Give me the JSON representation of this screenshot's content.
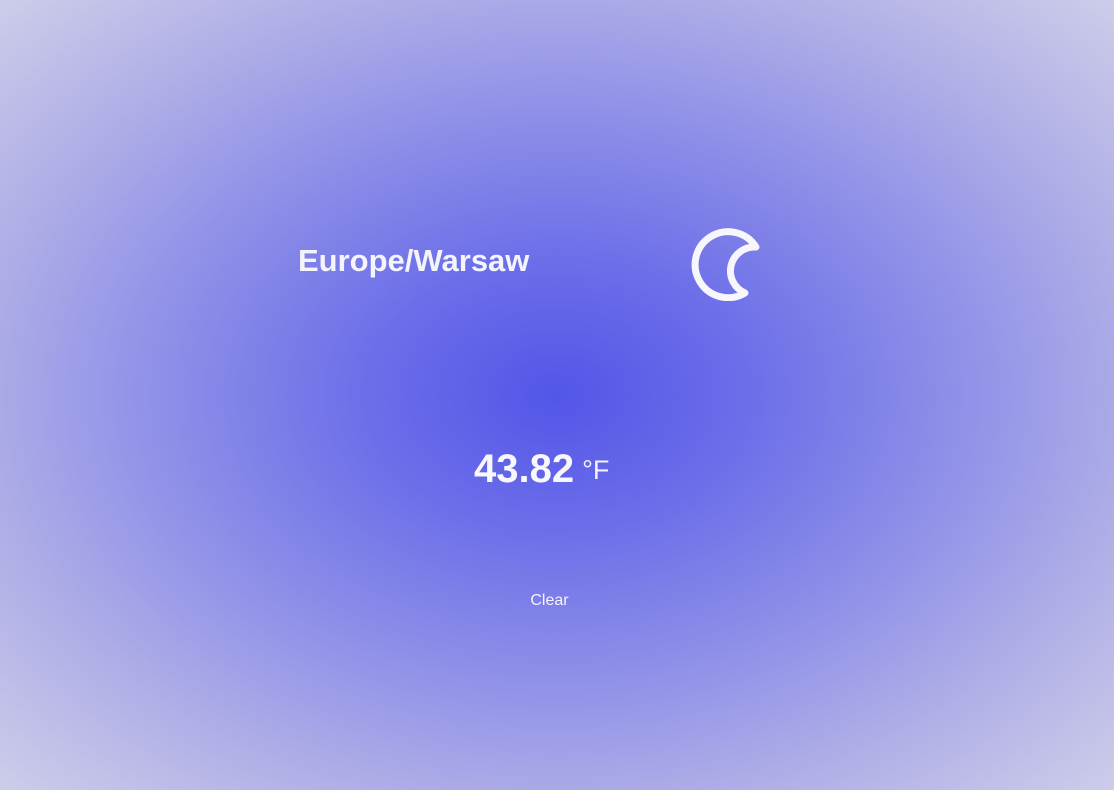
{
  "location": {
    "timezone": "Europe/Warsaw"
  },
  "weather": {
    "icon": "moon-icon",
    "temperature": "43.82",
    "unit": "°F",
    "description": "Clear"
  }
}
